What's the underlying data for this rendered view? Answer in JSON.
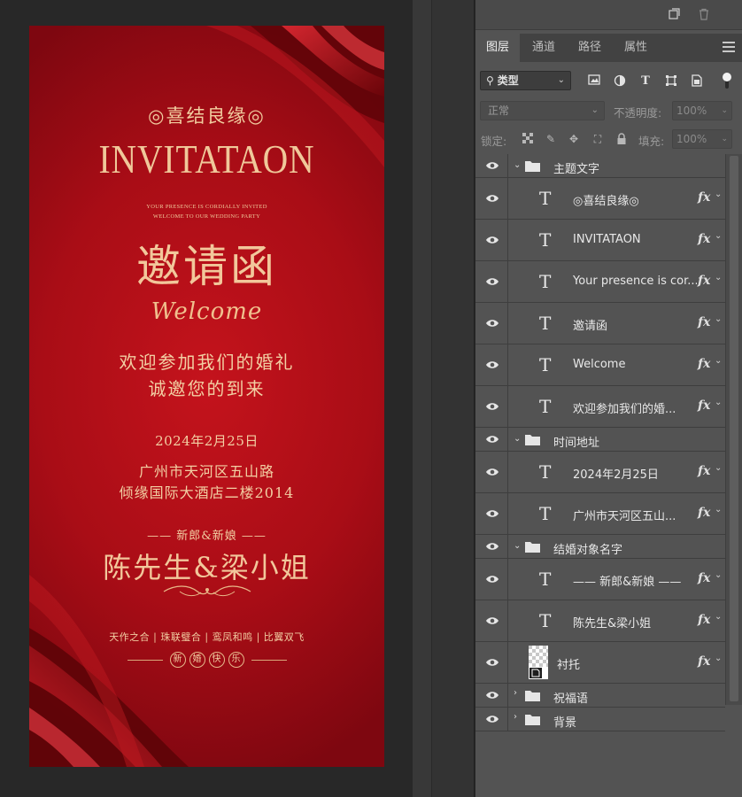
{
  "poster": {
    "subtitle_top": "◎喜结良缘◎",
    "title_en": "INVITATAON",
    "presence_line1": "YOUR PRESENCE IS CORDIALLY INVITED",
    "presence_line2": "WELCOME TO OUR WEDDING PARTY",
    "title_cn": "邀请函",
    "welcome": "Welcome",
    "greeting_line1": "欢迎参加我们的婚礼",
    "greeting_line2": "诚邀您的到来",
    "date": "2024年2月25日",
    "address_line1": "广州市天河区五山路",
    "address_line2": "倾缘国际大酒店二楼2014",
    "couple_label": "—— 新郎&新娘 ——",
    "couple_names": "陈先生&梁小姐",
    "blessings": "天作之合 | 珠联璧合 | 鸾凤和鸣 | 比翼双飞",
    "happy_chars": [
      "新",
      "婚",
      "快",
      "乐"
    ],
    "colors": {
      "background": "#b00f18",
      "text": "#f0c89a"
    }
  },
  "panel": {
    "tabs": [
      {
        "label": "图层",
        "active": true
      },
      {
        "label": "通道",
        "active": false
      },
      {
        "label": "路径",
        "active": false
      },
      {
        "label": "属性",
        "active": false
      }
    ],
    "filter": {
      "icon": "search-icon",
      "label": "类型"
    },
    "blend_mode": "正常",
    "opacity_label": "不透明度:",
    "opacity_value": "100%",
    "lock_label": "锁定:",
    "fill_label": "填充:",
    "fill_value": "100%",
    "layers": [
      {
        "type": "group",
        "name": "主题文字",
        "expanded": true
      },
      {
        "type": "text",
        "name": "◎喜结良缘◎",
        "fx": "fx"
      },
      {
        "type": "text",
        "name": "INVITATAON",
        "fx": "fx"
      },
      {
        "type": "text",
        "name": "Your presence is cor...",
        "fx": "fx"
      },
      {
        "type": "text",
        "name": "邀请函",
        "fx": "fx"
      },
      {
        "type": "text",
        "name": "Welcome",
        "fx": "fx"
      },
      {
        "type": "text",
        "name": "欢迎参加我们的婚...",
        "fx": "fx"
      },
      {
        "type": "group",
        "name": "时间地址",
        "expanded": true
      },
      {
        "type": "text",
        "name": "2024年2月25日",
        "fx": "fx"
      },
      {
        "type": "text",
        "name": "广州市天河区五山...",
        "fx": "fx"
      },
      {
        "type": "group",
        "name": "结婚对象名字",
        "expanded": true
      },
      {
        "type": "text",
        "name": "—— 新郎&新娘 ——",
        "fx": "fx"
      },
      {
        "type": "text",
        "name": "陈先生&梁小姐",
        "fx": "fx"
      },
      {
        "type": "image",
        "name": "衬托",
        "fx": "fx"
      },
      {
        "type": "group",
        "name": "祝福语",
        "expanded": false
      },
      {
        "type": "group",
        "name": "背景",
        "expanded": false
      }
    ]
  }
}
